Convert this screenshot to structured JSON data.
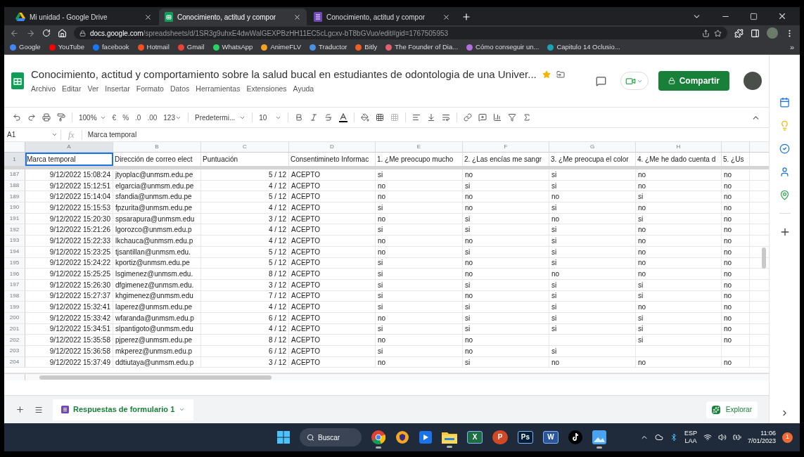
{
  "browser": {
    "tabs": [
      {
        "title": "Mi unidad - Google Drive",
        "kind": "drive",
        "selected": false
      },
      {
        "title": "Conocimiento, actitud y compor",
        "kind": "sheets",
        "selected": true
      },
      {
        "title": "Conocimiento, actitud y compor",
        "kind": "forms",
        "selected": false
      }
    ],
    "url_host": "docs.google.com",
    "url_path": "/spreadsheets/d/1SR3g9uhxE4dwWalGEXPBzHH11EC5cLgcxv-bT8bGVuo/edit#gid=1767505953",
    "bookmarks": [
      {
        "label": "Google",
        "color": "#4285f4"
      },
      {
        "label": "YouTube",
        "color": "#ff0000"
      },
      {
        "label": "facebook",
        "color": "#1877f2"
      },
      {
        "label": "Hotmail",
        "color": "#f25022"
      },
      {
        "label": "Gmail",
        "color": "#ea4335"
      },
      {
        "label": "WhatsApp",
        "color": "#25d366"
      },
      {
        "label": "AnimeFLV",
        "color": "#f4a020"
      },
      {
        "label": "Traductor",
        "color": "#4a90e2"
      },
      {
        "label": "Bitly",
        "color": "#ee6123"
      },
      {
        "label": "The Founder of Dia...",
        "color": "#e06070"
      },
      {
        "label": "Cómo conseguir un...",
        "color": "#b070e0"
      },
      {
        "label": "Capitulo 14 Oclusio...",
        "color": "#1aa3b0"
      }
    ],
    "more_bookmarks": "»"
  },
  "doc": {
    "title": "Conocimiento, actitud y comportamiento sobre la salud bucal en estudiantes de odontologia de una Univer...",
    "starred": true,
    "menu": [
      "Archivo",
      "Editar",
      "Ver",
      "Insertar",
      "Formato",
      "Datos",
      "Herramientas",
      "Extensiones",
      "Ayuda"
    ],
    "share_button": "Compartir"
  },
  "toolbar": {
    "zoom": "100%",
    "currency": "€",
    "percent": "%",
    "decrease_decimals": ".0",
    "increase_decimals": ".00",
    "more_formats": "123",
    "font": "Predetermi...",
    "font_size": "10"
  },
  "formula_bar": {
    "cell": "A1",
    "fx": "fx",
    "value": "Marca temporal"
  },
  "sheet": {
    "columns": [
      "A",
      "B",
      "C",
      "D",
      "E",
      "F",
      "G",
      "H"
    ],
    "header_row": {
      "number": "1",
      "cells": [
        "Marca temporal",
        "Dirección de correo elect",
        "Puntuación",
        "Consentimineto Informac",
        "1. ¿Me preocupo mucho",
        "2. ¿Las encías me sangr",
        "3. ¿Me preocupa el color",
        "4. ¿Me he dado cuenta d",
        "5. ¿Us"
      ]
    },
    "rows": [
      {
        "number": "187",
        "cells": [
          "9/12/2022 15:08:24",
          "jtyoplac@unmsm.edu.pe",
          "5 / 12",
          "ACEPTO",
          "si",
          "no",
          "si",
          "no",
          "no"
        ]
      },
      {
        "number": "188",
        "cells": [
          "9/12/2022 15:12:51",
          "elgarcia@unmsm.edu.pe",
          "4 / 12",
          "ACEPTO",
          "no",
          "si",
          "si",
          "no",
          "no"
        ]
      },
      {
        "number": "189",
        "cells": [
          "9/12/2022 15:14:04",
          "sfandia@unmsm.edu.pe",
          "5 / 12",
          "ACEPTO",
          "no",
          "no",
          "no",
          "si",
          "no"
        ]
      },
      {
        "number": "190",
        "cells": [
          "9/12/2022 15:15:53",
          "fpzurita@unmsm.edu.pe",
          "4 / 12",
          "ACEPTO",
          "si",
          "no",
          "si",
          "no",
          "no"
        ]
      },
      {
        "number": "191",
        "cells": [
          "9/12/2022 15:20:30",
          "spsarapura@unmsm.edu",
          "3 / 12",
          "ACEPTO",
          "no",
          "si",
          "no",
          "si",
          "no"
        ]
      },
      {
        "number": "192",
        "cells": [
          "9/12/2022 15:21:26",
          "lgorozco@unmsm.edu.p",
          "4 / 12",
          "ACEPTO",
          "si",
          "si",
          "si",
          "no",
          "no"
        ]
      },
      {
        "number": "193",
        "cells": [
          "9/12/2022 15:22:33",
          "lkchauca@unmsm.edu.p",
          "4 / 12",
          "ACEPTO",
          "no",
          "no",
          "si",
          "no",
          "no"
        ]
      },
      {
        "number": "194",
        "cells": [
          "9/12/2022 15:23:25",
          "tjsantillan@unmsm.edu.",
          "5 / 12",
          "ACEPTO",
          "no",
          "si",
          "si",
          "no",
          "no"
        ]
      },
      {
        "number": "195",
        "cells": [
          "9/12/2022 15:24:22",
          "kportiz@unmsm.edu.pe",
          "5 / 12",
          "ACEPTO",
          "si",
          "no",
          "si",
          "no",
          "no"
        ]
      },
      {
        "number": "196",
        "cells": [
          "9/12/2022 15:25:25",
          "lsgimenez@unmsm.edu.",
          "8 / 12",
          "ACEPTO",
          "si",
          "no",
          "no",
          "no",
          "no"
        ]
      },
      {
        "number": "197",
        "cells": [
          "9/12/2022 15:26:30",
          "dfgimenez@unmsm.edu.",
          "3 / 12",
          "ACEPTO",
          "si",
          "si",
          "si",
          "si",
          "no"
        ]
      },
      {
        "number": "198",
        "cells": [
          "9/12/2022 15:27:37",
          "khgimenez@unmsm.edu",
          "7 / 12",
          "ACEPTO",
          "si",
          "no",
          "si",
          "si",
          "no"
        ]
      },
      {
        "number": "199",
        "cells": [
          "9/12/2022 15:32:41",
          "laperez@unmsm.edu.pe",
          "4 / 12",
          "ACEPTO",
          "si",
          "si",
          "si",
          "no",
          "no"
        ]
      },
      {
        "number": "200",
        "cells": [
          "9/12/2022 15:33:42",
          "wfaranda@unmsm.edu.p",
          "6 / 12",
          "ACEPTO",
          "no",
          "si",
          "si",
          "si",
          "no"
        ]
      },
      {
        "number": "201",
        "cells": [
          "9/12/2022 15:34:51",
          "slpantigoto@unmsm.edu",
          "4 / 12",
          "ACEPTO",
          "si",
          "si",
          "si",
          "si",
          "no"
        ]
      },
      {
        "number": "202",
        "cells": [
          "9/12/2022 15:35:58",
          "pjperez@unmsm.edu.pe",
          "8 / 12",
          "ACEPTO",
          "no",
          "no",
          null,
          "si",
          "no"
        ]
      },
      {
        "number": "203",
        "cells": [
          "9/12/2022 15:36:58",
          "mkperez@unmsm.edu.p",
          "6 / 12",
          "ACEPTO",
          "si",
          "no",
          "si",
          null,
          null
        ]
      },
      {
        "number": "204",
        "cells": [
          "9/12/2022 15:37:49",
          "ddtiutaya@unmsm.edu.p",
          "3 / 12",
          "ACEPTO",
          "no",
          "si",
          "no",
          "no",
          "no"
        ]
      }
    ]
  },
  "sheet_tabs": [
    {
      "label": "Respuestas de formulario 1",
      "selected": true
    }
  ],
  "explore_button": "Explorar",
  "taskbar": {
    "search": "Buscar",
    "apps": [
      {
        "kind": "chrome",
        "active": true
      },
      {
        "kind": "shield",
        "active": false
      },
      {
        "kind": "media",
        "active": false
      },
      {
        "kind": "folder",
        "active": true
      },
      {
        "kind": "tile",
        "label": "X",
        "color": "#1d6f42",
        "active": false
      },
      {
        "kind": "round",
        "label": "P",
        "color": "#d24726",
        "active": false
      },
      {
        "kind": "tile",
        "label": "Ps",
        "color": "#001e36",
        "active": false
      },
      {
        "kind": "tile",
        "label": "W",
        "color": "#2b579a",
        "active": false
      },
      {
        "kind": "tiktok",
        "active": false
      },
      {
        "kind": "photos",
        "active": true
      }
    ],
    "language": "ESP",
    "layout": "LAA",
    "time": "11:06",
    "date": "7/01/2023",
    "notifications": "1"
  }
}
